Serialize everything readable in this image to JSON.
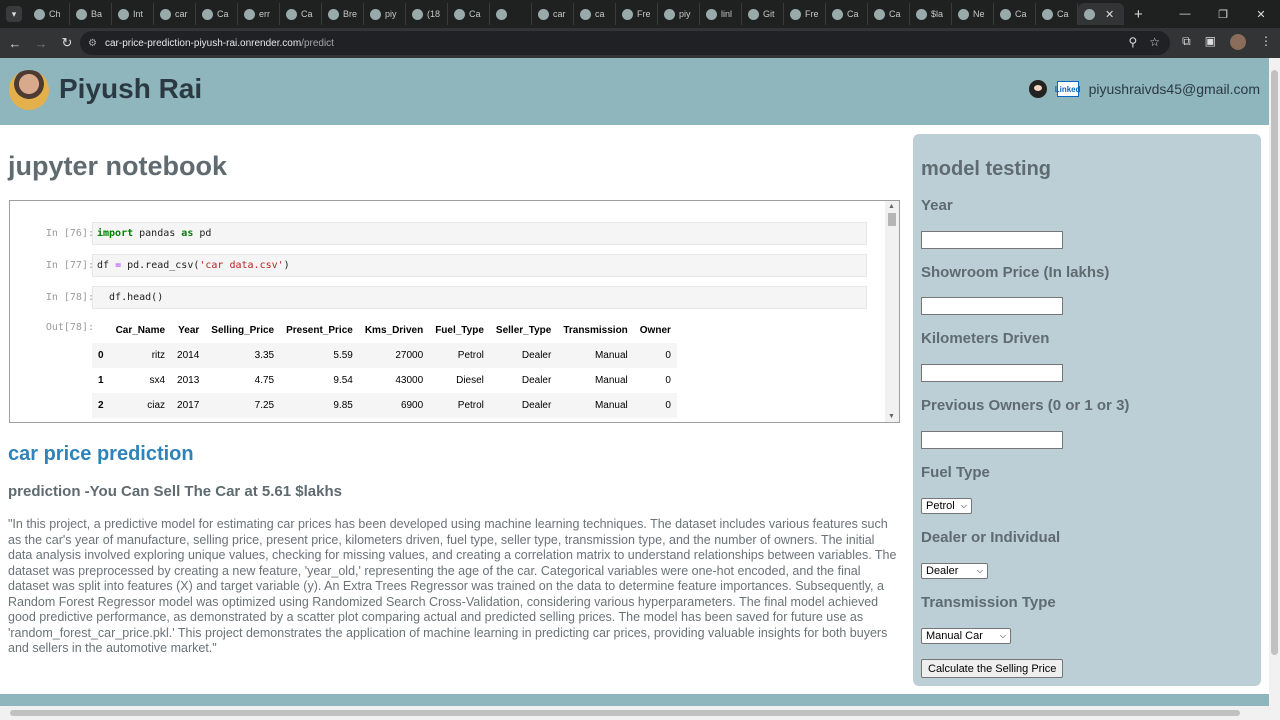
{
  "browser": {
    "tabs": [
      "Ch",
      "Ba",
      "Int",
      "car",
      "Ca",
      "err",
      "Ca",
      "Bre",
      "piy",
      "(18",
      "Ca",
      "",
      "car",
      "ca",
      "Fre",
      "piy",
      "linl",
      "Git",
      "Fre",
      "Ca",
      "Ca",
      "$la",
      "Ne",
      "Ca",
      "Ca"
    ],
    "url_host": "car-price-prediction-piyush-rai.onrender.com",
    "url_path": "/predict"
  },
  "header": {
    "name": "Piyush Rai",
    "linkedin_text": "Linked",
    "email": "piyushraivds45@gmail.com"
  },
  "notebook": {
    "heading": "jupyter notebook",
    "cells": [
      {
        "prompt": "In [76]:",
        "code_kw": "import",
        "code_rest1": " pandas ",
        "code_kw2": "as",
        "code_rest2": " pd"
      },
      {
        "prompt": "In [77]:",
        "code_a": "df ",
        "code_eq": "=",
        "code_b": " pd.read_csv(",
        "code_str": "'car data.csv'",
        "code_c": ")"
      },
      {
        "prompt": "In [78]:",
        "code": "  df.head()"
      },
      {
        "prompt": "Out[78]:"
      }
    ],
    "table": {
      "columns": [
        "",
        "Car_Name",
        "Year",
        "Selling_Price",
        "Present_Price",
        "Kms_Driven",
        "Fuel_Type",
        "Seller_Type",
        "Transmission",
        "Owner"
      ],
      "rows": [
        [
          "0",
          "ritz",
          "2014",
          "3.35",
          "5.59",
          "27000",
          "Petrol",
          "Dealer",
          "Manual",
          "0"
        ],
        [
          "1",
          "sx4",
          "2013",
          "4.75",
          "9.54",
          "43000",
          "Diesel",
          "Dealer",
          "Manual",
          "0"
        ],
        [
          "2",
          "ciaz",
          "2017",
          "7.25",
          "9.85",
          "6900",
          "Petrol",
          "Dealer",
          "Manual",
          "0"
        ]
      ]
    }
  },
  "prediction": {
    "heading": "car price prediction",
    "result": "prediction -You Can Sell The Car at 5.61 $lakhs",
    "description": "\"In this project, a predictive model for estimating car prices has been developed using machine learning techniques. The dataset includes various features such as the car's year of manufacture, selling price, present price, kilometers driven, fuel type, seller type, transmission type, and the number of owners. The initial data analysis involved exploring unique values, checking for missing values, and creating a correlation matrix to understand relationships between variables. The dataset was preprocessed by creating a new feature, 'year_old,' representing the age of the car. Categorical variables were one-hot encoded, and the final dataset was split into features (X) and target variable (y). An Extra Trees Regressor was trained on the data to determine feature importances. Subsequently, a Random Forest Regressor model was optimized using Randomized Search Cross-Validation, considering various hyperparameters. The final model achieved good predictive performance, as demonstrated by a scatter plot comparing actual and predicted selling prices. The model has been saved for future use as 'random_forest_car_price.pkl.' This project demonstrates the application of machine learning in predicting car prices, providing valuable insights for both buyers and sellers in the automotive market.\""
  },
  "form": {
    "title": "model testing",
    "year_label": "Year",
    "year_value": "",
    "showroom_label": "Showroom Price (In lakhs)",
    "showroom_value": "",
    "kms_label": "Kilometers Driven",
    "kms_value": "",
    "owners_label": "Previous Owners (0 or 1 or 3)",
    "owners_value": "",
    "fuel_label": "Fuel Type",
    "fuel_selected": "Petrol",
    "seller_label": "Dealer or Individual",
    "seller_selected": "Dealer",
    "transmission_label": "Transmission Type",
    "transmission_selected": "Manual Car",
    "submit_label": "Calculate the Selling Price"
  },
  "colors": {
    "header_bg": "#8fb5bd",
    "panel_bg": "#bccfd7",
    "accent_blue": "#2f83b8"
  }
}
